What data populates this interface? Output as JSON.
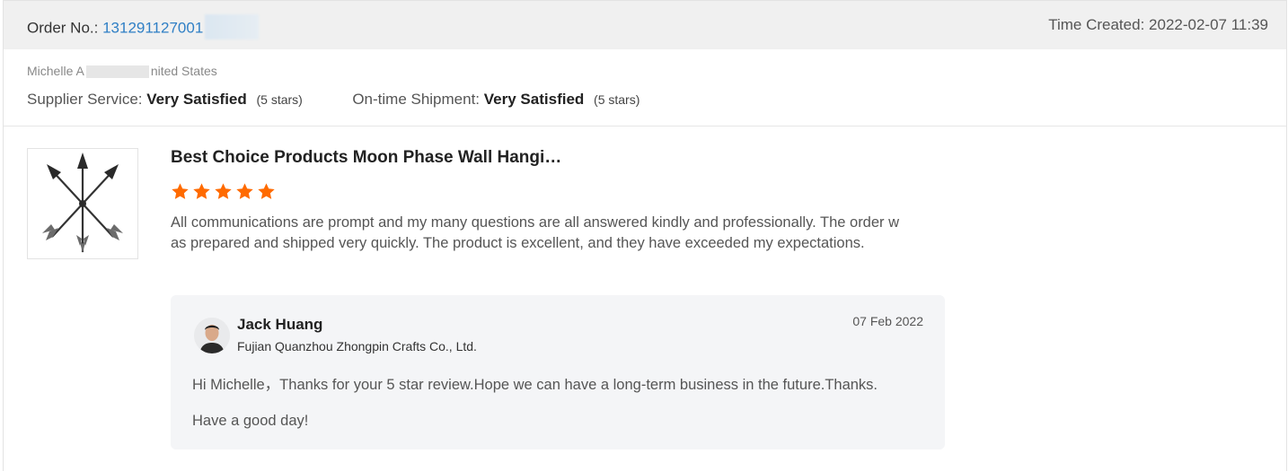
{
  "header": {
    "order_label": "Order No.:",
    "order_number": "131291127001",
    "time_label": "Time Created:",
    "time_value": "2022-02-07 11:39"
  },
  "buyer": {
    "name_start": "Michelle A",
    "name_end": "nited States"
  },
  "ratings": {
    "supplier_label": "Supplier Service:",
    "supplier_value": "Very Satisfied",
    "supplier_stars": "(5 stars)",
    "shipment_label": "On-time Shipment:",
    "shipment_value": "Very Satisfied",
    "shipment_stars": "(5 stars)"
  },
  "product": {
    "title": "Best Choice Products Moon Phase Wall Hangi…",
    "rating": 5,
    "star_color": "#ff6a00",
    "review_text": "All communications are prompt and my many questions are all answered kindly and professionally. The order was prepared and shipped very quickly. The product is excellent, and they have exceeded my expectations."
  },
  "reply": {
    "name": "Jack Huang",
    "company": "Fujian Quanzhou Zhongpin Crafts Co., Ltd.",
    "date": "07 Feb 2022",
    "message_line1": "Hi Michelle，Thanks for your 5 star review.Hope we can have a long-term business in the future.Thanks.",
    "message_line2": "Have a good day!"
  },
  "colors": {
    "link": "#2f7fc5",
    "header_bg": "#f0f0f0",
    "reply_bg": "#f4f5f7"
  }
}
